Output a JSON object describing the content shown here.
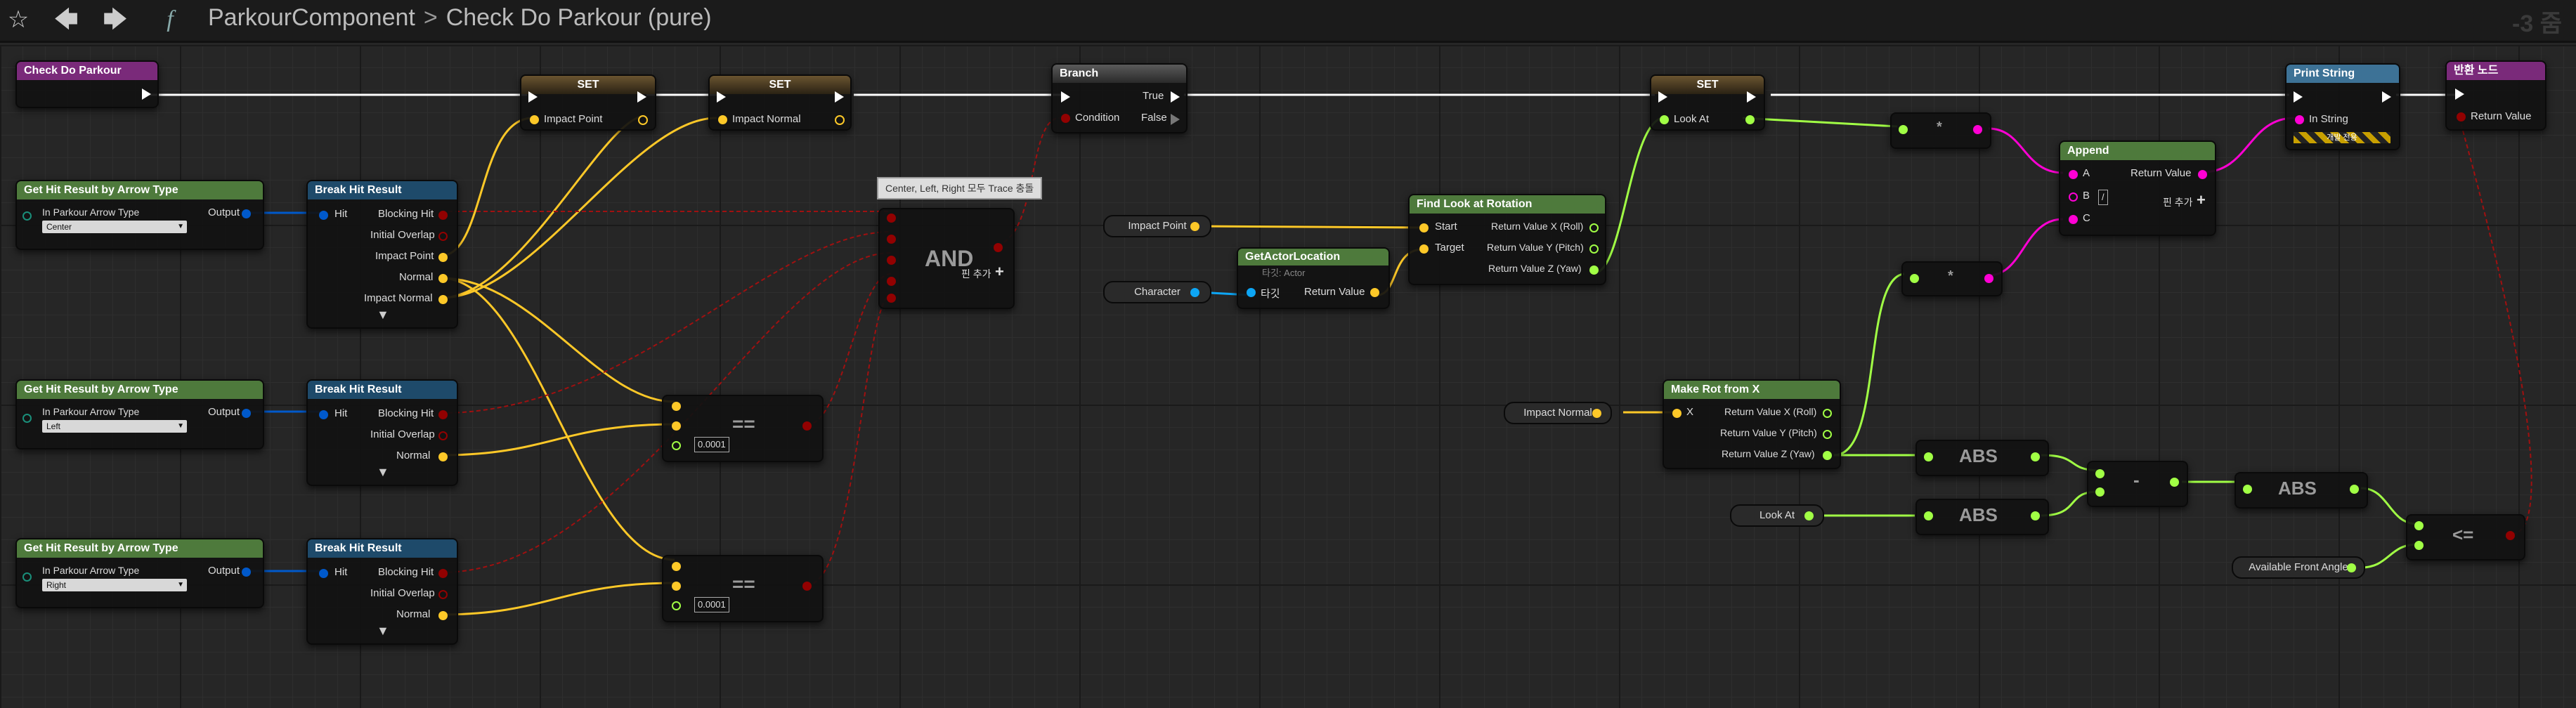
{
  "toolbar": {
    "star_icon": "☆",
    "back_icon": "🡄",
    "forward_icon": "🡆",
    "function_icon": "f",
    "breadcrumb_parent": "ParkourComponent",
    "breadcrumb_separator": ">",
    "breadcrumb_current": "Check Do Parkour (pure)",
    "zoom": "-3 줌"
  },
  "nodes": {
    "entry": {
      "title": "Check Do Parkour"
    },
    "set1": {
      "title": "SET",
      "pin": "Impact Point"
    },
    "set2": {
      "title": "SET",
      "pin": "Impact Normal"
    },
    "branch": {
      "title": "Branch",
      "condition": "Condition",
      "true": "True",
      "false": "False"
    },
    "set3": {
      "title": "SET",
      "pin": "Look At"
    },
    "print": {
      "title": "Print String",
      "pin": "In String",
      "dev_only": "개발 전용"
    },
    "return": {
      "title": "반환 노드",
      "pin": "Return Value"
    },
    "ghr1": {
      "title": "Get Hit Result by Arrow Type",
      "pin_in": "In Parkour Arrow Type",
      "value": "Center",
      "out": "Output"
    },
    "ghr2": {
      "title": "Get Hit Result by Arrow Type",
      "pin_in": "In Parkour Arrow Type",
      "value": "Left",
      "out": "Output"
    },
    "ghr3": {
      "title": "Get Hit Result by Arrow Type",
      "pin_in": "In Parkour Arrow Type",
      "value": "Right",
      "out": "Output"
    },
    "bhr1": {
      "title": "Break Hit Result",
      "hit": "Hit",
      "p1": "Blocking Hit",
      "p2": "Initial Overlap",
      "p3": "Impact Point",
      "p4": "Normal",
      "p5": "Impact Normal"
    },
    "bhr2": {
      "title": "Break Hit Result",
      "hit": "Hit",
      "p1": "Blocking Hit",
      "p2": "Initial Overlap",
      "p3": "Normal"
    },
    "bhr3": {
      "title": "Break Hit Result",
      "hit": "Hit",
      "p1": "Blocking Hit",
      "p2": "Initial Overlap",
      "p3": "Normal"
    },
    "and": {
      "label": "AND",
      "add_pin": "핀 추가",
      "comment": "Center, Left, Right 모두 Trace 충돌"
    },
    "eq1": {
      "label": "==",
      "tolerance": "0.0001"
    },
    "eq2": {
      "label": "==",
      "tolerance": "0.0001"
    },
    "var_impact_point": {
      "label": "Impact Point"
    },
    "var_character": {
      "label": "Character"
    },
    "getactor": {
      "title": "GetActorLocation",
      "subtitle": "타깃: Actor",
      "target": "타깃",
      "ret": "Return Value"
    },
    "findlook": {
      "title": "Find Look at Rotation",
      "start": "Start",
      "target": "Target",
      "r1": "Return Value X (Roll)",
      "r2": "Return Value Y (Pitch)",
      "r3": "Return Value Z (Yaw)"
    },
    "mul1": {
      "label": "*"
    },
    "mul2": {
      "label": "*"
    },
    "append": {
      "title": "Append",
      "a": "A",
      "b": "B",
      "c": "C",
      "ret": "Return Value",
      "add_pin": "핀 추가"
    },
    "var_impact_normal": {
      "label": "Impact Normal"
    },
    "makerot": {
      "title": "Make Rot from X",
      "x": "X",
      "r1": "Return Value X (Roll)",
      "r2": "Return Value Y (Pitch)",
      "r3": "Return Value Z (Yaw)"
    },
    "abs1": {
      "label": "ABS"
    },
    "abs2": {
      "label": "ABS"
    },
    "abs3": {
      "label": "ABS"
    },
    "minus": {
      "label": "-"
    },
    "var_look_at": {
      "label": "Look At"
    },
    "var_front_angle": {
      "label": "Available Front Angle"
    },
    "le": {
      "label": "<="
    }
  },
  "colors": {
    "exec": "#ffffff",
    "bool": "#920101",
    "vector": "#fdc828",
    "float": "#a1ff45",
    "string": "#ff00d4",
    "object": "#0da6f5",
    "struct": "#0059cb",
    "func_header": "#3d7296",
    "pure_header": "#4e7a3c",
    "set_header": "#6a5430",
    "branch_header": "#5a5a5a"
  }
}
